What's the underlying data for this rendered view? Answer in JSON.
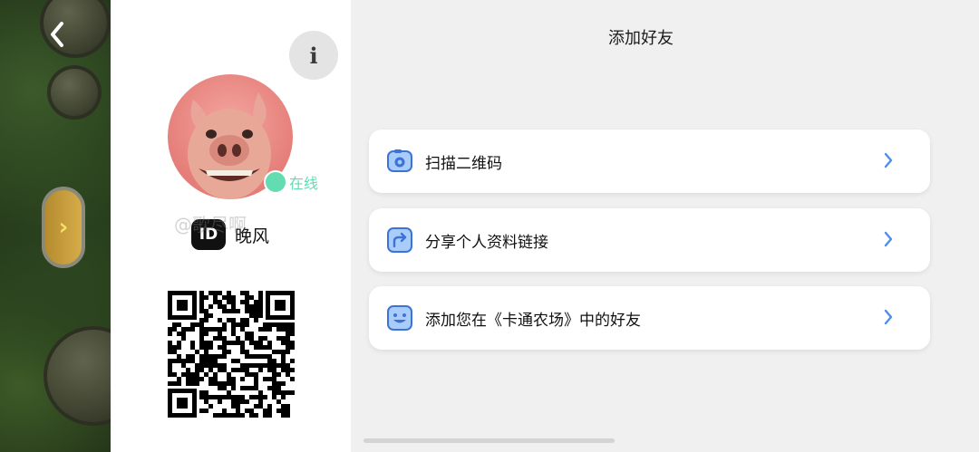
{
  "game": {
    "back_icon": "chevron-left-icon"
  },
  "profile": {
    "info_label": "i",
    "status": "在线",
    "id_badge": "ID",
    "username": "晚风"
  },
  "main": {
    "title": "添加好友",
    "options": [
      {
        "label": "扫描二维码",
        "icon": "camera-icon"
      },
      {
        "label": "分享个人资料链接",
        "icon": "share-icon"
      },
      {
        "label": "添加您在《卡通农场》中的好友",
        "icon": "smile-icon"
      }
    ],
    "watermark": "@歌尽啊"
  },
  "colors": {
    "accent": "#4a8ef0",
    "online": "#62dcb0",
    "icon_fill": "#3c73d8",
    "icon_bg": "#a9ccf8"
  }
}
